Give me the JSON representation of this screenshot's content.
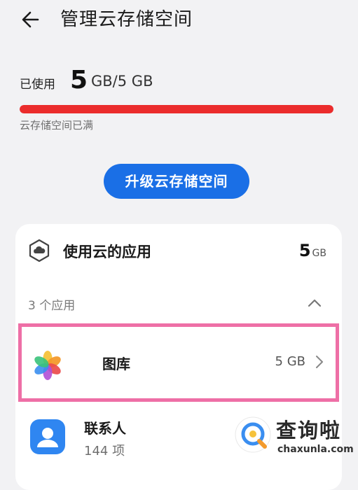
{
  "header": {
    "title": "管理云存储空间"
  },
  "usage": {
    "label": "已使用",
    "used_value": "5",
    "used_total": "GB/5 GB",
    "progress_fraction": 1.0,
    "status_note": "云存储空间已满"
  },
  "upgrade_button": {
    "label": "升级云存储空间"
  },
  "cloud_apps": {
    "title": "使用云的应用",
    "size_value": "5",
    "size_unit": "GB",
    "app_count_label": "3 个应用",
    "items": [
      {
        "name": "图库",
        "size": "5 GB"
      },
      {
        "name": "联系人",
        "detail": "144 项"
      }
    ]
  },
  "watermark": {
    "text": "查询啦",
    "url": "chaxunla.com"
  },
  "colors": {
    "accent": "#1a6fe6",
    "progress_full": "#eb2c2c",
    "highlight": "#ee6fa6",
    "background": "#f2f2f4"
  },
  "icons": [
    "back-arrow-icon",
    "cloud-apps-icon",
    "chevron-up-icon",
    "gallery-pinwheel-icon",
    "chevron-right-icon",
    "contacts-icon"
  ]
}
